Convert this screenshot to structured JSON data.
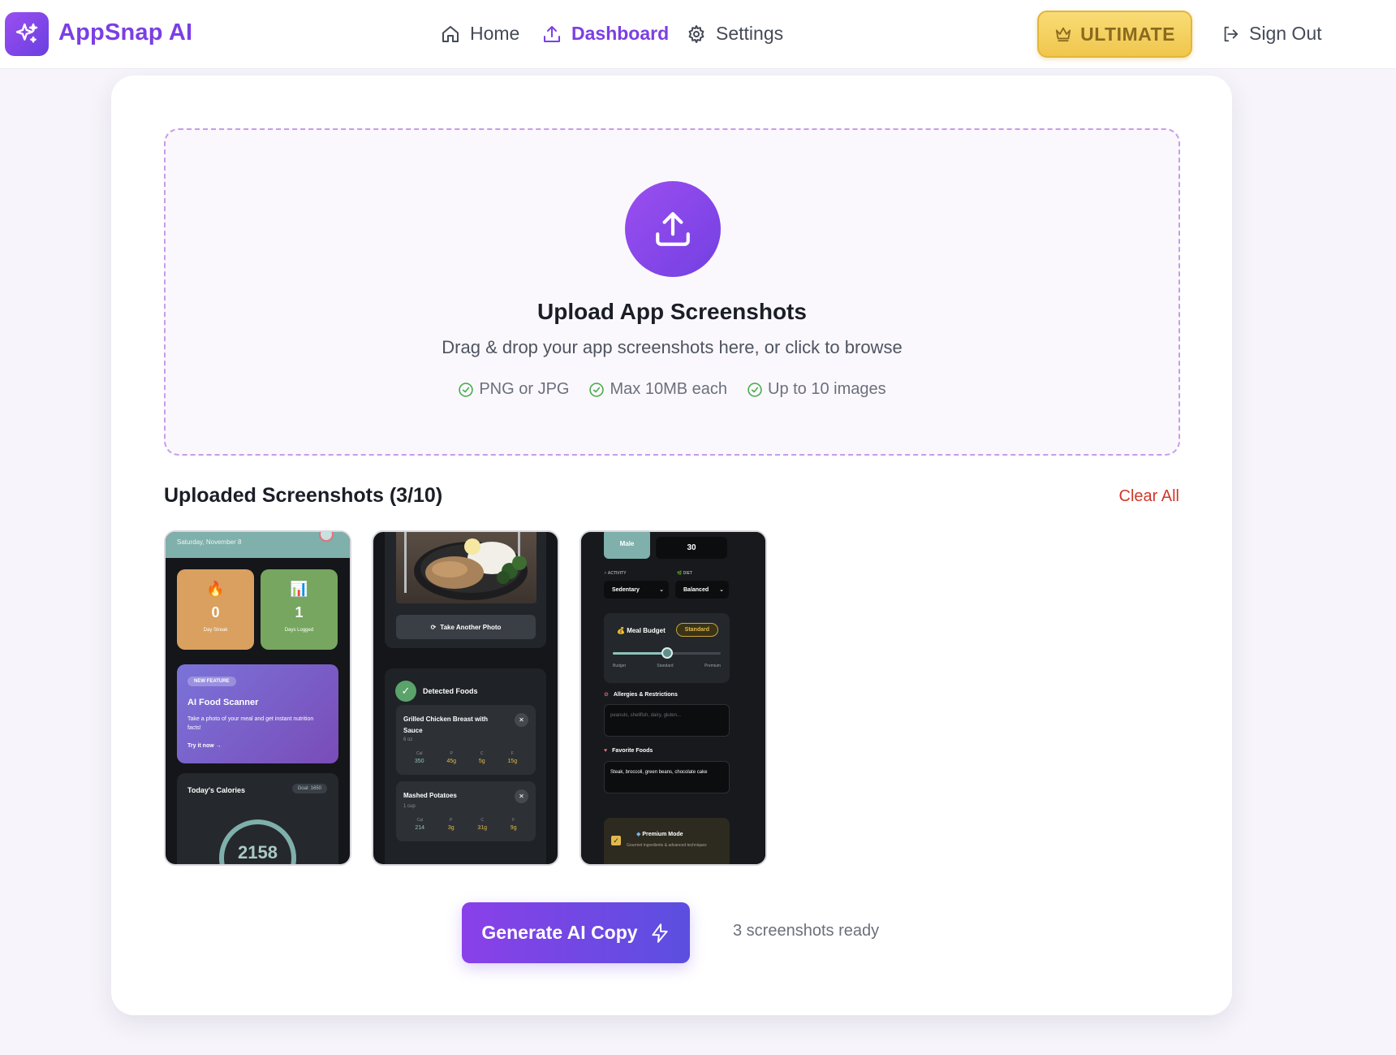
{
  "app": {
    "name": "AppSnap AI"
  },
  "nav": {
    "links": [
      {
        "label": "Home",
        "icon": "home-icon"
      },
      {
        "label": "Dashboard",
        "icon": "upload-icon",
        "active": true
      },
      {
        "label": "Settings",
        "icon": "gear-icon"
      }
    ],
    "plan_badge": "ULTIMATE",
    "sign_out": "Sign Out"
  },
  "upload": {
    "title": "Upload App Screenshots",
    "subtitle": "Drag & drop your app screenshots here, or click to browse",
    "features": [
      "PNG or JPG",
      "Max 10MB each",
      "Up to 10 images"
    ]
  },
  "uploaded": {
    "title": "Uploaded Screenshots (3/10)",
    "clear_label": "Clear All",
    "screens": [
      {
        "date": "Saturday, November 8",
        "stats": [
          {
            "value": "0",
            "label": "Day Streak"
          },
          {
            "value": "1",
            "label": "Days Logged"
          }
        ],
        "promo": {
          "badge": "NEW FEATURE",
          "title": "AI Food Scanner",
          "desc": "Take a photo of your meal and get instant nutrition facts!",
          "cta": "Try it now →"
        },
        "calories": {
          "title": "Today's Calories",
          "goal": "Goal: 1650",
          "value": "2158"
        }
      },
      {
        "button": "Take Another Photo",
        "detected_title": "Detected Foods",
        "macro_labels": [
          "Cal",
          "P",
          "C",
          "F"
        ],
        "items": [
          {
            "name": "Grilled Chicken Breast with Sauce",
            "serving": "6 oz",
            "macros": [
              "350",
              "45g",
              "5g",
              "15g"
            ]
          },
          {
            "name": "Mashed Potatoes",
            "serving": "1 cup",
            "macros": [
              "214",
              "3g",
              "31g",
              "9g"
            ]
          }
        ]
      },
      {
        "gender": "Male",
        "age": "30",
        "activity_label": "ACTIVITY",
        "activity": "Sedentary",
        "diet_label": "DIET",
        "diet": "Balanced",
        "budget_title": "Meal Budget",
        "budget_level": "Standard",
        "budget_ticks": [
          "Budget",
          "Standard",
          "Premium"
        ],
        "allergies_title": "Allergies & Restrictions",
        "allergies_placeholder": "peanuts, shellfish, dairy, gluten...",
        "favorites_title": "Favorite Foods",
        "favorites_value": "Steak, broccoli, green beans, chocolate cake",
        "premium_title": "Premium Mode",
        "premium_desc": "Gourmet ingredients & advanced techniques"
      }
    ]
  },
  "generate": {
    "label": "Generate AI Copy",
    "status": "3 screenshots ready"
  },
  "colors": {
    "accent": "#7b3fe4",
    "gold": "#f0c64d",
    "danger": "#d0382b",
    "success": "#4caf50"
  }
}
